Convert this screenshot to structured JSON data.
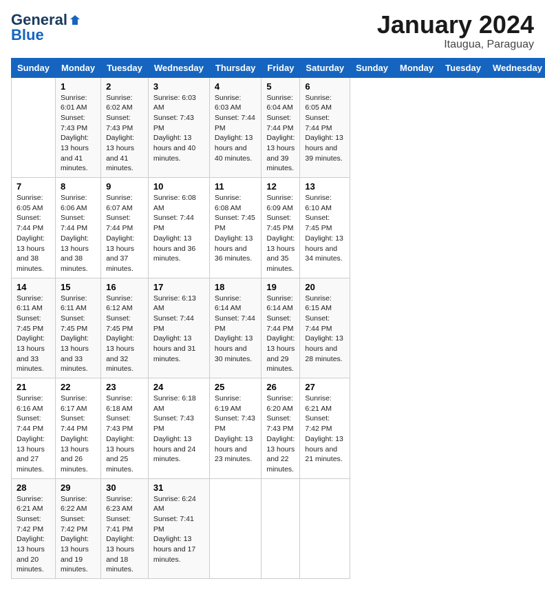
{
  "logo": {
    "line1": "General",
    "line2": "Blue"
  },
  "title": "January 2024",
  "location": "Itaugua, Paraguay",
  "days_of_week": [
    "Sunday",
    "Monday",
    "Tuesday",
    "Wednesday",
    "Thursday",
    "Friday",
    "Saturday"
  ],
  "weeks": [
    [
      {
        "day": "",
        "sunrise": "",
        "sunset": "",
        "daylight": ""
      },
      {
        "day": "1",
        "sunrise": "Sunrise: 6:01 AM",
        "sunset": "Sunset: 7:43 PM",
        "daylight": "Daylight: 13 hours and 41 minutes."
      },
      {
        "day": "2",
        "sunrise": "Sunrise: 6:02 AM",
        "sunset": "Sunset: 7:43 PM",
        "daylight": "Daylight: 13 hours and 41 minutes."
      },
      {
        "day": "3",
        "sunrise": "Sunrise: 6:03 AM",
        "sunset": "Sunset: 7:43 PM",
        "daylight": "Daylight: 13 hours and 40 minutes."
      },
      {
        "day": "4",
        "sunrise": "Sunrise: 6:03 AM",
        "sunset": "Sunset: 7:44 PM",
        "daylight": "Daylight: 13 hours and 40 minutes."
      },
      {
        "day": "5",
        "sunrise": "Sunrise: 6:04 AM",
        "sunset": "Sunset: 7:44 PM",
        "daylight": "Daylight: 13 hours and 39 minutes."
      },
      {
        "day": "6",
        "sunrise": "Sunrise: 6:05 AM",
        "sunset": "Sunset: 7:44 PM",
        "daylight": "Daylight: 13 hours and 39 minutes."
      }
    ],
    [
      {
        "day": "7",
        "sunrise": "Sunrise: 6:05 AM",
        "sunset": "Sunset: 7:44 PM",
        "daylight": "Daylight: 13 hours and 38 minutes."
      },
      {
        "day": "8",
        "sunrise": "Sunrise: 6:06 AM",
        "sunset": "Sunset: 7:44 PM",
        "daylight": "Daylight: 13 hours and 38 minutes."
      },
      {
        "day": "9",
        "sunrise": "Sunrise: 6:07 AM",
        "sunset": "Sunset: 7:44 PM",
        "daylight": "Daylight: 13 hours and 37 minutes."
      },
      {
        "day": "10",
        "sunrise": "Sunrise: 6:08 AM",
        "sunset": "Sunset: 7:44 PM",
        "daylight": "Daylight: 13 hours and 36 minutes."
      },
      {
        "day": "11",
        "sunrise": "Sunrise: 6:08 AM",
        "sunset": "Sunset: 7:45 PM",
        "daylight": "Daylight: 13 hours and 36 minutes."
      },
      {
        "day": "12",
        "sunrise": "Sunrise: 6:09 AM",
        "sunset": "Sunset: 7:45 PM",
        "daylight": "Daylight: 13 hours and 35 minutes."
      },
      {
        "day": "13",
        "sunrise": "Sunrise: 6:10 AM",
        "sunset": "Sunset: 7:45 PM",
        "daylight": "Daylight: 13 hours and 34 minutes."
      }
    ],
    [
      {
        "day": "14",
        "sunrise": "Sunrise: 6:11 AM",
        "sunset": "Sunset: 7:45 PM",
        "daylight": "Daylight: 13 hours and 33 minutes."
      },
      {
        "day": "15",
        "sunrise": "Sunrise: 6:11 AM",
        "sunset": "Sunset: 7:45 PM",
        "daylight": "Daylight: 13 hours and 33 minutes."
      },
      {
        "day": "16",
        "sunrise": "Sunrise: 6:12 AM",
        "sunset": "Sunset: 7:45 PM",
        "daylight": "Daylight: 13 hours and 32 minutes."
      },
      {
        "day": "17",
        "sunrise": "Sunrise: 6:13 AM",
        "sunset": "Sunset: 7:44 PM",
        "daylight": "Daylight: 13 hours and 31 minutes."
      },
      {
        "day": "18",
        "sunrise": "Sunrise: 6:14 AM",
        "sunset": "Sunset: 7:44 PM",
        "daylight": "Daylight: 13 hours and 30 minutes."
      },
      {
        "day": "19",
        "sunrise": "Sunrise: 6:14 AM",
        "sunset": "Sunset: 7:44 PM",
        "daylight": "Daylight: 13 hours and 29 minutes."
      },
      {
        "day": "20",
        "sunrise": "Sunrise: 6:15 AM",
        "sunset": "Sunset: 7:44 PM",
        "daylight": "Daylight: 13 hours and 28 minutes."
      }
    ],
    [
      {
        "day": "21",
        "sunrise": "Sunrise: 6:16 AM",
        "sunset": "Sunset: 7:44 PM",
        "daylight": "Daylight: 13 hours and 27 minutes."
      },
      {
        "day": "22",
        "sunrise": "Sunrise: 6:17 AM",
        "sunset": "Sunset: 7:44 PM",
        "daylight": "Daylight: 13 hours and 26 minutes."
      },
      {
        "day": "23",
        "sunrise": "Sunrise: 6:18 AM",
        "sunset": "Sunset: 7:43 PM",
        "daylight": "Daylight: 13 hours and 25 minutes."
      },
      {
        "day": "24",
        "sunrise": "Sunrise: 6:18 AM",
        "sunset": "Sunset: 7:43 PM",
        "daylight": "Daylight: 13 hours and 24 minutes."
      },
      {
        "day": "25",
        "sunrise": "Sunrise: 6:19 AM",
        "sunset": "Sunset: 7:43 PM",
        "daylight": "Daylight: 13 hours and 23 minutes."
      },
      {
        "day": "26",
        "sunrise": "Sunrise: 6:20 AM",
        "sunset": "Sunset: 7:43 PM",
        "daylight": "Daylight: 13 hours and 22 minutes."
      },
      {
        "day": "27",
        "sunrise": "Sunrise: 6:21 AM",
        "sunset": "Sunset: 7:42 PM",
        "daylight": "Daylight: 13 hours and 21 minutes."
      }
    ],
    [
      {
        "day": "28",
        "sunrise": "Sunrise: 6:21 AM",
        "sunset": "Sunset: 7:42 PM",
        "daylight": "Daylight: 13 hours and 20 minutes."
      },
      {
        "day": "29",
        "sunrise": "Sunrise: 6:22 AM",
        "sunset": "Sunset: 7:42 PM",
        "daylight": "Daylight: 13 hours and 19 minutes."
      },
      {
        "day": "30",
        "sunrise": "Sunrise: 6:23 AM",
        "sunset": "Sunset: 7:41 PM",
        "daylight": "Daylight: 13 hours and 18 minutes."
      },
      {
        "day": "31",
        "sunrise": "Sunrise: 6:24 AM",
        "sunset": "Sunset: 7:41 PM",
        "daylight": "Daylight: 13 hours and 17 minutes."
      },
      {
        "day": "",
        "sunrise": "",
        "sunset": "",
        "daylight": ""
      },
      {
        "day": "",
        "sunrise": "",
        "sunset": "",
        "daylight": ""
      },
      {
        "day": "",
        "sunrise": "",
        "sunset": "",
        "daylight": ""
      }
    ]
  ]
}
